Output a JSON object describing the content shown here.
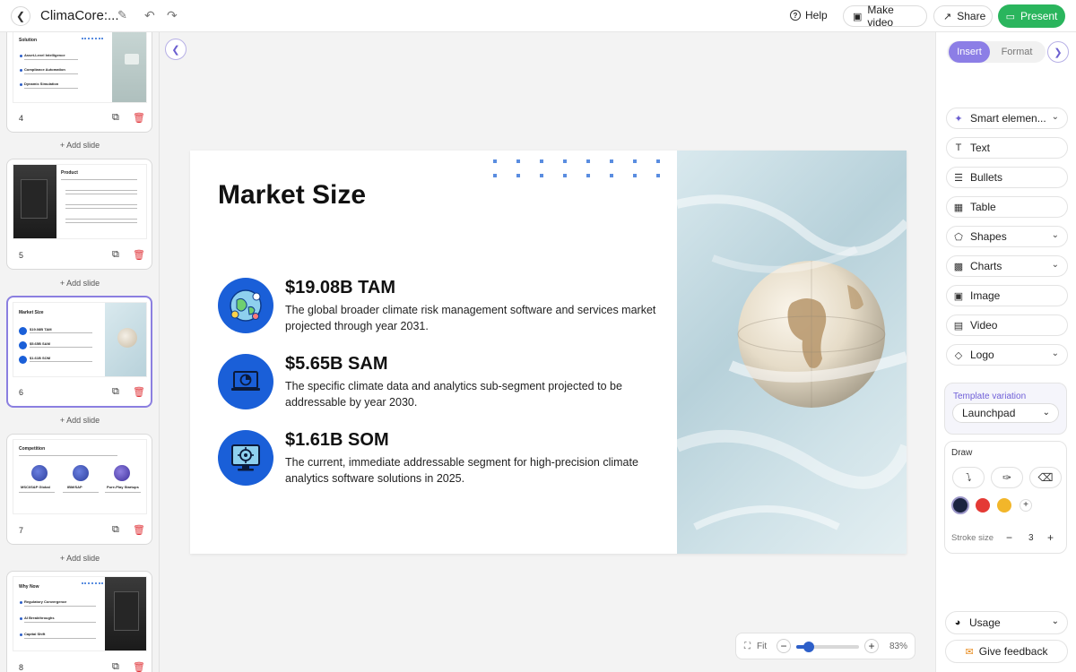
{
  "topbar": {
    "title": "ClimaCore:...",
    "help_label": "Help",
    "make_video_label": "Make video",
    "share_label": "Share",
    "present_label": "Present"
  },
  "slides_panel": {
    "add_slide_label": "+ Add slide",
    "cards": [
      {
        "number": "4",
        "title": "Solution",
        "active": false
      },
      {
        "number": "5",
        "title": "Product",
        "active": false
      },
      {
        "number": "6",
        "title": "Market Size",
        "active": true
      },
      {
        "number": "7",
        "title": "Competition",
        "active": false
      },
      {
        "number": "8",
        "title": "Why Now",
        "active": false
      }
    ],
    "thumb_texts": {
      "solution_items": [
        "Asset-Level Intelligence",
        "Compliance Automation",
        "Dynamic Simulation"
      ],
      "market_items": [
        "$19.08B TAM",
        "$5.65B SAM",
        "$1.61B SOM"
      ],
      "competition_items": [
        "MSCI/S&P Global",
        "IBM/SAP",
        "Pure-Play Startups"
      ],
      "whynow_items": [
        "Regulatory Convergence",
        "AI Breakthroughs",
        "Capital Shift"
      ]
    }
  },
  "slide": {
    "title": "Market Size",
    "metrics": [
      {
        "heading": "$19.08B TAM",
        "description": "The global broader climate risk management software and services market projected through year 2031."
      },
      {
        "heading": "$5.65B SAM",
        "description": "The specific climate data and analytics sub-segment projected to be addressable by year 2030."
      },
      {
        "heading": "$1.61B SOM",
        "description": "The current, immediate addressable segment for high-precision climate analytics software solutions in 2025."
      }
    ]
  },
  "zoom": {
    "fit_label": "Fit",
    "percent": "83%",
    "level": 0.2
  },
  "right_panel": {
    "tab_insert": "Insert",
    "tab_format": "Format",
    "tools": [
      {
        "label": "Smart elemen...",
        "icon": "sparkle-icon",
        "has_chevron": true
      },
      {
        "label": "Text",
        "icon": "text-icon",
        "has_chevron": false
      },
      {
        "label": "Bullets",
        "icon": "bullets-icon",
        "has_chevron": false
      },
      {
        "label": "Table",
        "icon": "table-icon",
        "has_chevron": false
      },
      {
        "label": "Shapes",
        "icon": "shapes-icon",
        "has_chevron": true
      },
      {
        "label": "Charts",
        "icon": "charts-icon",
        "has_chevron": true
      },
      {
        "label": "Image",
        "icon": "image-icon",
        "has_chevron": false
      },
      {
        "label": "Video",
        "icon": "video-icon",
        "has_chevron": false
      },
      {
        "label": "Logo",
        "icon": "logo-icon",
        "has_chevron": true
      }
    ],
    "template_variation_label": "Template variation",
    "template_variation_value": "Launchpad",
    "draw_label": "Draw",
    "draw_colors": [
      "#1b2440",
      "#e43a35",
      "#f2b62a"
    ],
    "stroke_label": "Stroke size",
    "stroke_value": "3",
    "usage_label": "Usage",
    "feedback_label": "Give feedback"
  },
  "colors": {
    "accent": "#8c7ee6",
    "present": "#2ab55d",
    "icon_blue": "#1a5fd8",
    "delete_red": "#e0353a"
  }
}
